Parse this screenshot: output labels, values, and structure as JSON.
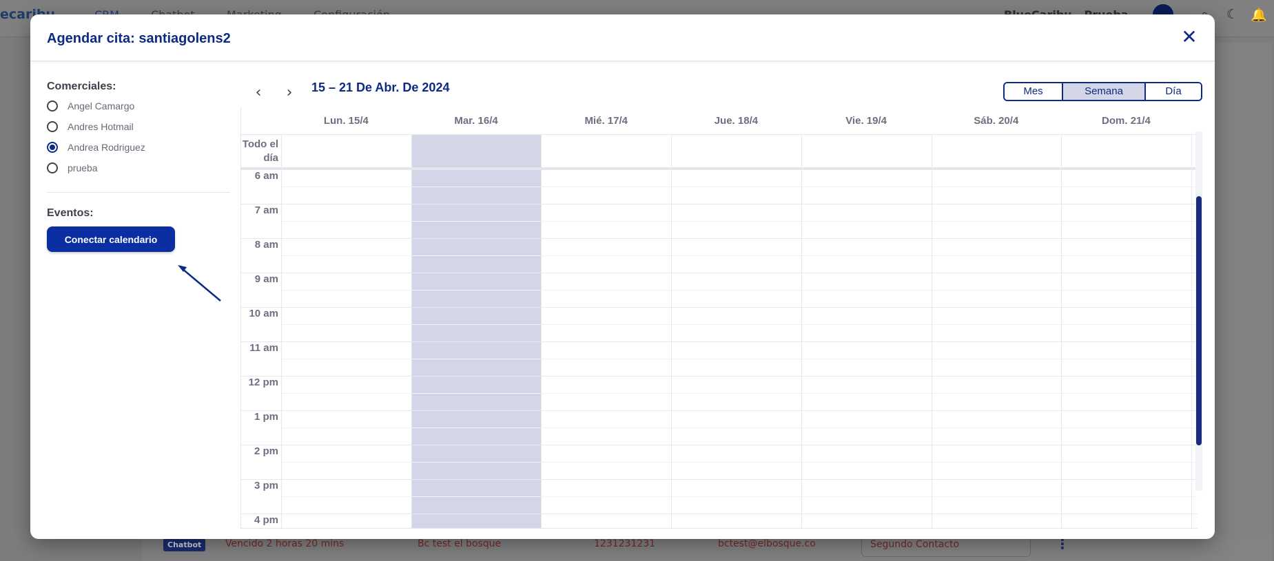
{
  "background_app": {
    "logo": "ecaribu",
    "nav": [
      "CRM",
      "Chatbot",
      "Marketing",
      "Configuración"
    ],
    "user": "BlueCaribu - Prueba",
    "row": {
      "badge": "Chatbot",
      "status": "Vencido 2 horas 20 mins",
      "name": "Bc test el bosque",
      "phone": "1231231231",
      "email": "bctest@elbosque.co",
      "stage": "Segundo Contacto"
    }
  },
  "modal": {
    "title": "Agendar cita: santiagolens2",
    "close_icon": "close-icon"
  },
  "sidebar": {
    "comerciales_label": "Comerciales:",
    "comerciales": [
      {
        "label": "Angel Camargo",
        "checked": false
      },
      {
        "label": "Andres Hotmail",
        "checked": false
      },
      {
        "label": "Andrea Rodriguez",
        "checked": true
      },
      {
        "label": "prueba",
        "checked": false
      }
    ],
    "eventos_label": "Eventos:",
    "connect_button": "Conectar calendario"
  },
  "calendar": {
    "range": "15 – 21 De Abr. De 2024",
    "prev_icon": "chevron-left-icon",
    "next_icon": "chevron-right-icon",
    "views": [
      "Mes",
      "Semana",
      "Día"
    ],
    "active_view": "Semana",
    "days": [
      "Lun. 15/4",
      "Mar. 16/4",
      "Mié. 17/4",
      "Jue. 18/4",
      "Vie. 19/4",
      "Sáb. 20/4",
      "Dom. 21/4"
    ],
    "today_index": 1,
    "all_day_label": "Todo el día",
    "hours": [
      "6 am",
      "7 am",
      "8 am",
      "9 am",
      "10 am",
      "11 am",
      "12 pm",
      "1 pm",
      "2 pm",
      "3 pm",
      "4 pm"
    ]
  },
  "colors": {
    "primary": "#0d2a85",
    "button": "#0b2fa3",
    "today_highlight": "#d4d6e7"
  }
}
